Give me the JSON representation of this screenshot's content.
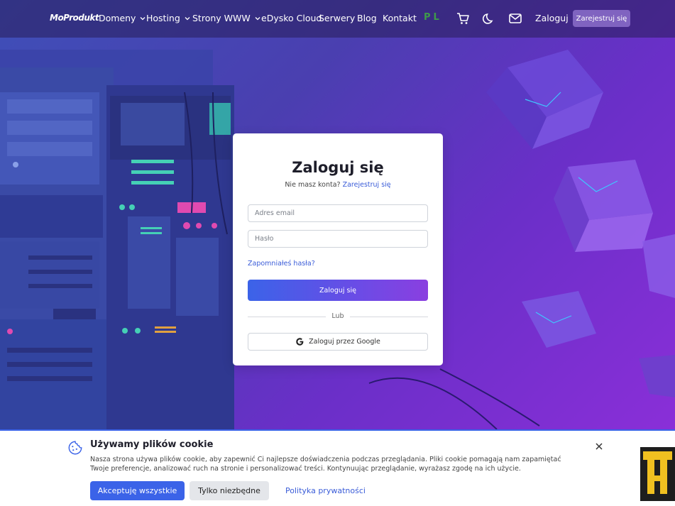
{
  "brand": {
    "logo": "MoProdukt"
  },
  "nav": {
    "items": [
      {
        "label": "Domeny",
        "dropdown": true
      },
      {
        "label": "Hosting",
        "dropdown": true
      },
      {
        "label": "Strony WWW",
        "dropdown": true
      },
      {
        "label": "eDysko Cloud",
        "dropdown": false
      },
      {
        "label": "Serwery",
        "dropdown": false
      },
      {
        "label": "Blog",
        "dropdown": false
      },
      {
        "label": "Kontakt",
        "dropdown": false
      }
    ],
    "language": "PL",
    "icons": [
      "cart-icon",
      "moon-icon",
      "mail-icon"
    ],
    "login_label": "Zaloguj",
    "register_label": "Zarejestruj się"
  },
  "login": {
    "title": "Zaloguj się",
    "subtitle": "Nie masz konta?",
    "register_link": "Zarejestruj się",
    "email_placeholder": "Adres email",
    "password_placeholder": "Hasło",
    "forgot_label": "Zapomniałeś hasła?",
    "submit_label": "Zaloguj się",
    "divider_label": "Lub",
    "google_label": "Zaloguj przez Google"
  },
  "cookie": {
    "title": "Używamy plików cookie",
    "text": "Nasza strona używa plików cookie, aby zapewnić Ci najlepsze doświadczenia podczas przeglądania. Pliki cookie pomagają nam zapamiętać Twoje preferencje, analizować ruch na stronie i personalizować treści. Kontynuując przeglądanie, wyrażasz zgodę na ich użycie.",
    "accept_label": "Akceptuję wszystkie",
    "essential_label": "Tylko niezbędne",
    "privacy_label": "Polityka prywatności"
  },
  "colors": {
    "accent": "#3b63e8",
    "link": "#3a5cd8",
    "hero_start": "#3f4fb8",
    "hero_end": "#8a2fd8"
  }
}
